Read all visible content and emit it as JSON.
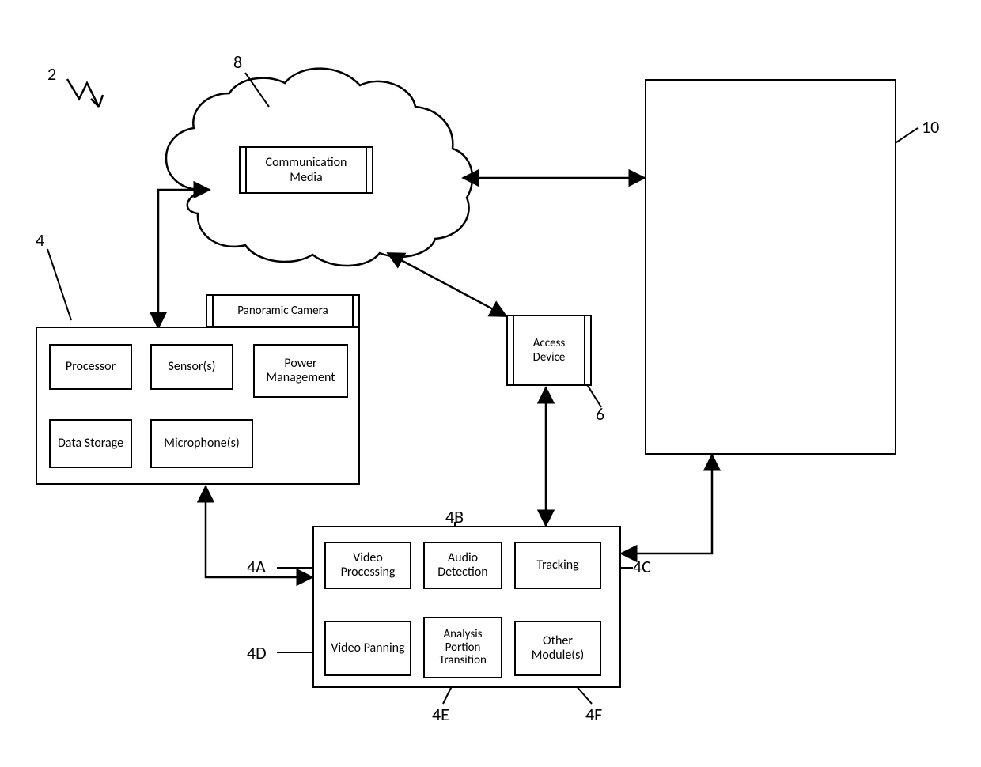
{
  "refs": {
    "system": "2",
    "device": "4",
    "access_device": "6",
    "cloud": "8",
    "server_box": "10",
    "mod_a": "4A",
    "mod_b": "4B",
    "mod_c": "4C",
    "mod_d": "4D",
    "mod_e": "4E",
    "mod_f": "4F"
  },
  "cloud": {
    "comm_media": "Communication Media"
  },
  "device": {
    "camera": "Panoramic Camera",
    "processor": "Processor",
    "sensors": "Sensor(s)",
    "power_mgmt": "Power Management",
    "data_storage": "Data Storage",
    "microphones": "Microphone(s)"
  },
  "access_device": {
    "label": "Access Device"
  },
  "modules": {
    "video_processing": "Video Processing",
    "audio_detection": "Audio Detection",
    "tracking": "Tracking",
    "video_panning": "Video Panning",
    "analysis_portion_transition": "Analysis Portion Transition",
    "other_modules": "Other Module(s)"
  }
}
